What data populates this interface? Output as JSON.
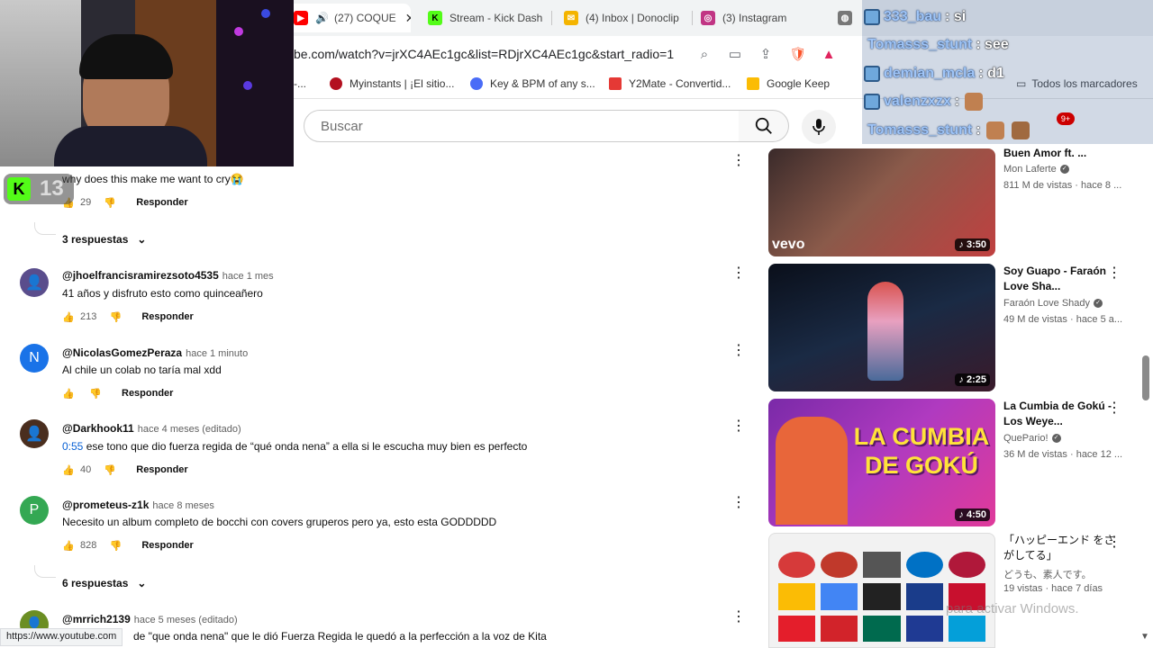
{
  "browser": {
    "tabs": [
      {
        "label": "(27) COQUE",
        "active": true,
        "audio": true
      },
      {
        "label": "Stream - Kick Dash"
      },
      {
        "label": "(4) Inbox | Donoclip"
      },
      {
        "label": "(3) Instagram"
      }
    ],
    "url": "be.com/watch?v=jrXC4AEc1gc&list=RDjrXC4AEc1gc&start_radio=1",
    "bookmarks": [
      {
        "label": "-..."
      },
      {
        "label": "Myinstants | ¡El sitio..."
      },
      {
        "label": "Key & BPM of any s..."
      },
      {
        "label": "Y2Mate - Convertid..."
      },
      {
        "label": "Google Keep"
      }
    ],
    "all_bookmarks": "Todos los marcadores",
    "status_url": "https://www.youtube.com"
  },
  "youtube": {
    "search_placeholder": "Buscar",
    "notification_count": "9+"
  },
  "comments": [
    {
      "author": "",
      "time": "",
      "text": "why does this make me want to cry😭",
      "likes": "29",
      "reply": "Responder",
      "replies_label": "3 respuestas"
    },
    {
      "author": "@jhoelfrancisramirezsoto4535",
      "time": "hace 1 mes",
      "text": "41 años y disfruto esto como quinceañero",
      "likes": "213",
      "reply": "Responder"
    },
    {
      "author": "@NicolasGomezPeraza",
      "time": "hace 1 minuto",
      "text": "Al chile un colab no taría mal xdd",
      "likes": "",
      "reply": "Responder",
      "avatar_letter": "N"
    },
    {
      "author": "@Darkhook11",
      "time": "hace 4 meses (editado)",
      "timestamp": "0:55",
      "text": " ese tono que dio fuerza regida de “qué onda nena” a ella si le escucha muy bien es perfecto",
      "likes": "40",
      "reply": "Responder"
    },
    {
      "author": "@prometeus-z1k",
      "time": "hace 8 meses",
      "text": "Necesito un album completo de bocchi con covers gruperos pero ya, esto esta GODDDDD",
      "likes": "828",
      "reply": "Responder",
      "avatar_letter": "P",
      "replies_label": "6 respuestas"
    },
    {
      "author": "@mrrich2139",
      "time": "hace 5 meses (editado)",
      "text": "de \"que onda nena\" que le dió Fuerza Regida le quedó a la perfección a la voz de Kita"
    }
  ],
  "recommendations": [
    {
      "title": "Buen Amor ft. ...",
      "channel": "Mon Laferte",
      "stats": "811 M de vistas · hace 8 ...",
      "duration": "3:50",
      "thumb_text": "vevo"
    },
    {
      "title": "Soy Guapo - Faraón Love Sha...",
      "channel": "Faraón Love Shady",
      "stats": "49 M de vistas · hace 5 a...",
      "duration": "2:25"
    },
    {
      "title": "La Cumbia de Gokú - Los Weye...",
      "channel": "QuePario!",
      "stats": "36 M de vistas · hace 12 ...",
      "duration": "4:50",
      "thumb_text": "LA CUMBIA DE GOKÚ"
    },
    {
      "title": "「ハッピーエンド をさがしてる」",
      "channel": "どうも、素人です。",
      "stats": "19 vistas · hace 7 días",
      "duration": ""
    }
  ],
  "chat": [
    {
      "user": "333_bau",
      "msg": ": si"
    },
    {
      "user": "Tomasss_stunt",
      "msg": ": see"
    },
    {
      "user": "demian_mcla",
      "msg": ": d1"
    },
    {
      "user": "valenzxzx",
      "msg": ":"
    },
    {
      "user": "Tomasss_stunt",
      "msg": ":"
    }
  ],
  "overlay": {
    "kick_count": "13",
    "activate_windows": "para activar Windows."
  },
  "colors": {
    "youtube_red": "#ff0000",
    "link_blue": "#065fd4",
    "kick_green": "#53fc18"
  }
}
